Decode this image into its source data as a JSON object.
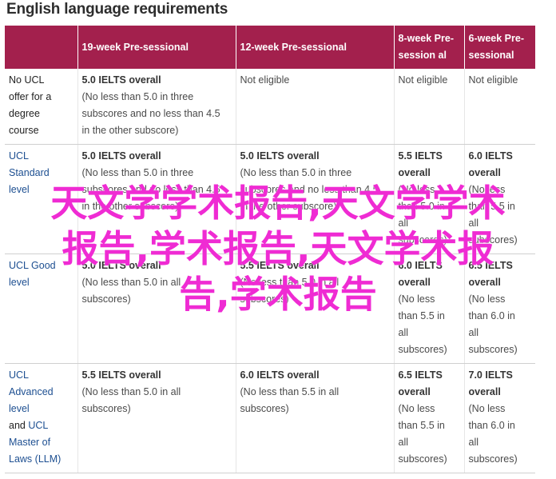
{
  "title": "English language requirements",
  "columns": [
    "",
    "19-week Pre-sessional",
    "12-week Pre-sessional",
    "8-week Pre-session al",
    "6-week Pre-sessional"
  ],
  "column_lines": [
    [
      ""
    ],
    [
      "19-week Pre-sessional"
    ],
    [
      "12-week Pre-sessional"
    ],
    [
      "8-week Pre-",
      "session al"
    ],
    [
      "6-week Pre-",
      "sessional"
    ]
  ],
  "rows": [
    {
      "head_lines": [
        {
          "text": "No UCL",
          "link": false
        },
        {
          "text": "offer for a",
          "link": false
        },
        {
          "text": "degree",
          "link": false
        },
        {
          "text": "course",
          "link": false
        }
      ],
      "cells": [
        {
          "strong": "5.0 IELTS overall",
          "sub_lines": [
            "(No less than 5.0 in three",
            "subscores and no less than 4.5",
            "in the other subscore)"
          ]
        },
        {
          "plain": "Not eligible"
        },
        {
          "plain": "Not eligible"
        },
        {
          "plain": "Not eligible"
        }
      ]
    },
    {
      "head_lines": [
        {
          "text": "UCL",
          "link": true
        },
        {
          "text": "Standard",
          "link": true
        },
        {
          "text": "level",
          "link": true
        }
      ],
      "cells": [
        {
          "strong": "5.0 IELTS overall",
          "sub_lines": [
            "(No less than 5.0 in three",
            "subscores and no less than 4.5",
            "in the other subscore)"
          ]
        },
        {
          "strong": "5.0 IELTS overall",
          "sub_lines": [
            "(No less than 5.0 in three",
            "subscores and no less than 4.5",
            "in the other subscore)"
          ]
        },
        {
          "strong_lines": [
            "5.5 IELTS",
            "overall"
          ],
          "sub_lines": [
            "(No less",
            "than 5.0 in",
            "all",
            "subscores)"
          ]
        },
        {
          "strong_lines": [
            "6.0 IELTS",
            "overall"
          ],
          "sub_lines": [
            "(No less",
            "than 5.5 in",
            "all",
            "subscores)"
          ]
        }
      ]
    },
    {
      "head_lines": [
        {
          "text": "UCL Good",
          "link": true
        },
        {
          "text": "level",
          "link": true
        }
      ],
      "cells": [
        {
          "strong": "5.0 IELTS overall",
          "sub_lines": [
            "(No less than 5.0 in all",
            "subscores)"
          ]
        },
        {
          "strong": "5.5 IELTS overall",
          "sub_lines": [
            "(No less than 5.0 in all",
            "subscores)"
          ]
        },
        {
          "strong_lines": [
            "6.0 IELTS",
            "overall"
          ],
          "sub_lines": [
            "(No less",
            "than 5.5 in",
            "all",
            "subscores)"
          ]
        },
        {
          "strong_lines": [
            "6.5 IELTS",
            "overall"
          ],
          "sub_lines": [
            "(No less",
            "than 6.0 in",
            "all",
            "subscores)"
          ]
        }
      ]
    },
    {
      "head_lines": [
        {
          "text": "UCL",
          "link": true
        },
        {
          "text": "Advanced",
          "link": true
        },
        {
          "text": "level",
          "link": true
        },
        {
          "text": "and ",
          "link": false,
          "tail": "UCL",
          "tail_link": true
        },
        {
          "text": "Master of",
          "link": true
        },
        {
          "text": "Laws (LLM)",
          "link": true
        }
      ],
      "cells": [
        {
          "strong": "5.5 IELTS overall",
          "sub_lines": [
            "(No less than 5.0 in all",
            "subscores)"
          ]
        },
        {
          "strong": "6.0 IELTS overall",
          "sub_lines": [
            "(No less than 5.5 in all",
            "subscores)"
          ]
        },
        {
          "strong_lines": [
            "6.5 IELTS",
            "overall"
          ],
          "sub_lines": [
            "(No less",
            "than 5.5 in",
            "all",
            "subscores)"
          ]
        },
        {
          "strong_lines": [
            "7.0 IELTS",
            "overall"
          ],
          "sub_lines": [
            "(No less",
            "than 6.0 in",
            "all",
            "subscores)"
          ]
        }
      ]
    }
  ],
  "watermark": [
    "天文学学术报告,天文学学术",
    "报告,学术报告,天文学术报",
    "告,学术报告"
  ],
  "colors": {
    "header_bg": "#a3204d",
    "link": "#1d4f91",
    "watermark": "#ef2bd3"
  }
}
